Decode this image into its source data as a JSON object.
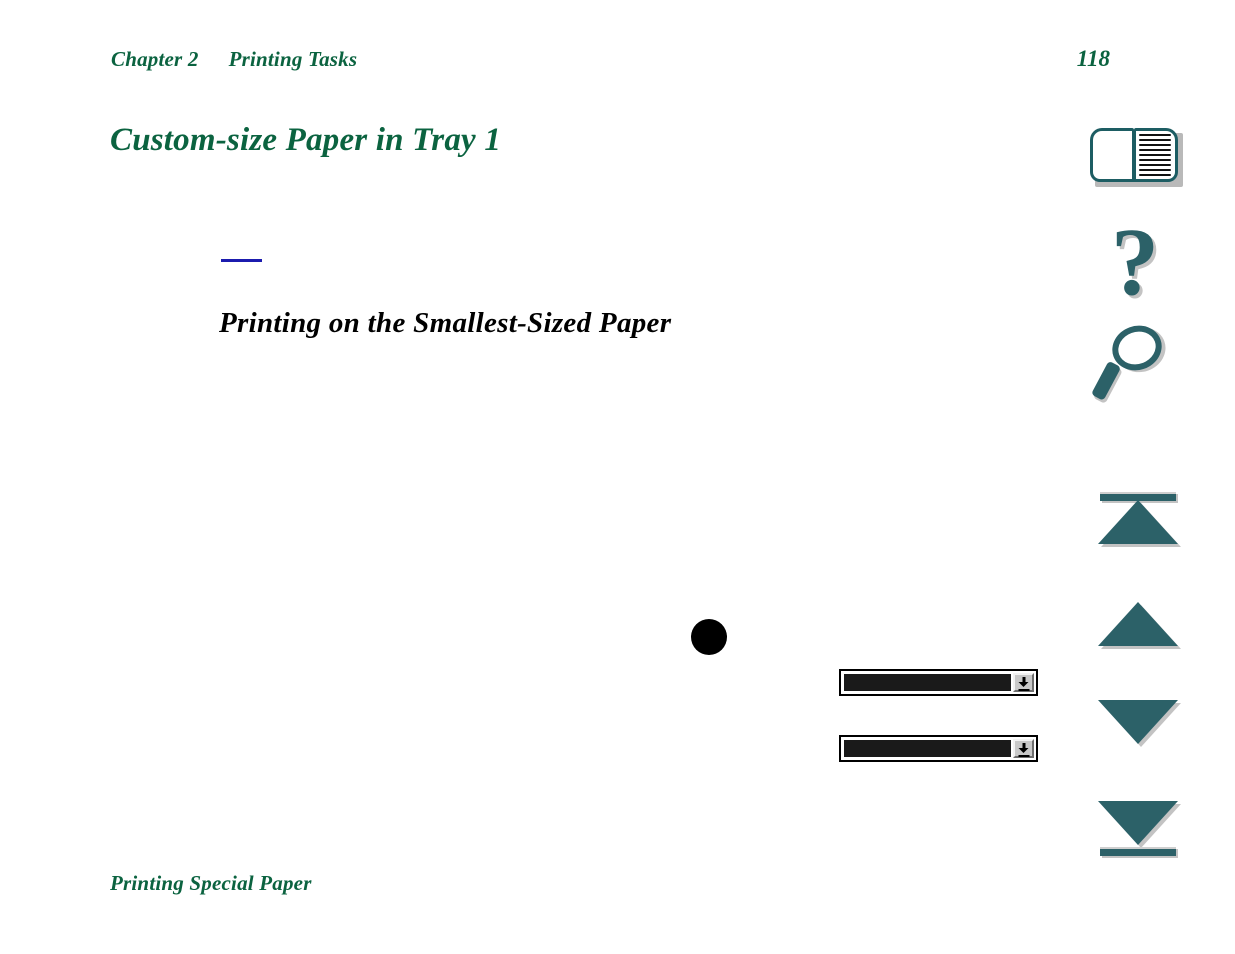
{
  "header": {
    "chapter_label": "Chapter 2",
    "chapter_title": "Printing Tasks",
    "page_number": "118"
  },
  "title": {
    "text": "Custom-size Paper in Tray 1"
  },
  "section": {
    "rule_color": "#1b1bae",
    "heading": "Printing on the Smallest-Sized Paper"
  },
  "body": {
    "bullet_marker": "filled-circle"
  },
  "widgets": [
    {
      "name": "combo-box-1",
      "value": "",
      "button_icon": "download-arrow-icon"
    },
    {
      "name": "combo-box-2",
      "value": "",
      "button_icon": "download-arrow-icon"
    }
  ],
  "nav_rail": {
    "items": [
      {
        "icon": "open-book-icon",
        "label": "Contents"
      },
      {
        "icon": "question-mark-icon",
        "label": "Help"
      },
      {
        "icon": "magnifying-glass-icon",
        "label": "Search"
      },
      {
        "icon": "top-of-document-icon",
        "label": "Go to top"
      },
      {
        "icon": "previous-page-icon",
        "label": "Previous page"
      },
      {
        "icon": "next-page-icon",
        "label": "Next page"
      },
      {
        "icon": "end-of-document-icon",
        "label": "Go to end"
      }
    ]
  },
  "footer": {
    "link_text": "Printing Special Paper"
  },
  "colors": {
    "accent_green": "#0b6340",
    "icon_teal": "#2c6168",
    "rule_blue": "#1b1bae"
  }
}
